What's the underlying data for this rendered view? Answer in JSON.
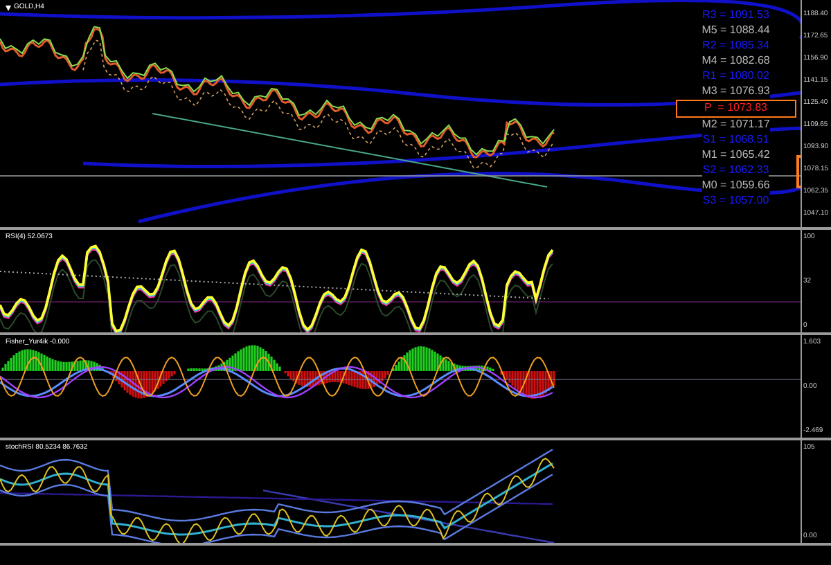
{
  "main_chart": {
    "title": "GOLD,H4",
    "pivot_levels": [
      {
        "label": "R3 = 1091.53",
        "kind": "resistance"
      },
      {
        "label": "M5 = 1088.44",
        "kind": "mid"
      },
      {
        "label": "R2 = 1085.34",
        "kind": "resistance"
      },
      {
        "label": "M4 = 1082.68",
        "kind": "mid"
      },
      {
        "label": "R1 = 1080.02",
        "kind": "resistance"
      },
      {
        "label": "M3 = 1076.93",
        "kind": "mid"
      },
      {
        "label": "P  = 1073.83",
        "kind": "pivot"
      },
      {
        "label": "M2 = 1071.17",
        "kind": "mid"
      },
      {
        "label": "S1 = 1068.51",
        "kind": "support"
      },
      {
        "label": "M1 = 1065.42",
        "kind": "mid"
      },
      {
        "label": "S2 = 1062.33",
        "kind": "support"
      },
      {
        "label": "M0 = 1059.66",
        "kind": "mid"
      },
      {
        "label": "S3 = 1057.00",
        "kind": "support"
      }
    ],
    "price_axis": [
      "1188.40",
      "1172.65",
      "1156.90",
      "1141.15",
      "1125.40",
      "1109.65",
      "1093.90",
      "1078.15",
      "1062.35",
      "1047.10"
    ]
  },
  "indicators": [
    {
      "kind": "rsi",
      "title": "RSI(4) 52.0673",
      "axis": [
        "100",
        "32",
        "0"
      ]
    },
    {
      "kind": "fisher",
      "title": "Fisher_Yur4ik -0.000",
      "axis": [
        "1.603",
        "0.00",
        "-2.469"
      ]
    },
    {
      "kind": "stoch",
      "title": "stochRSI 80.5234 86.7632",
      "axis": [
        "105",
        "0.00"
      ]
    }
  ]
}
